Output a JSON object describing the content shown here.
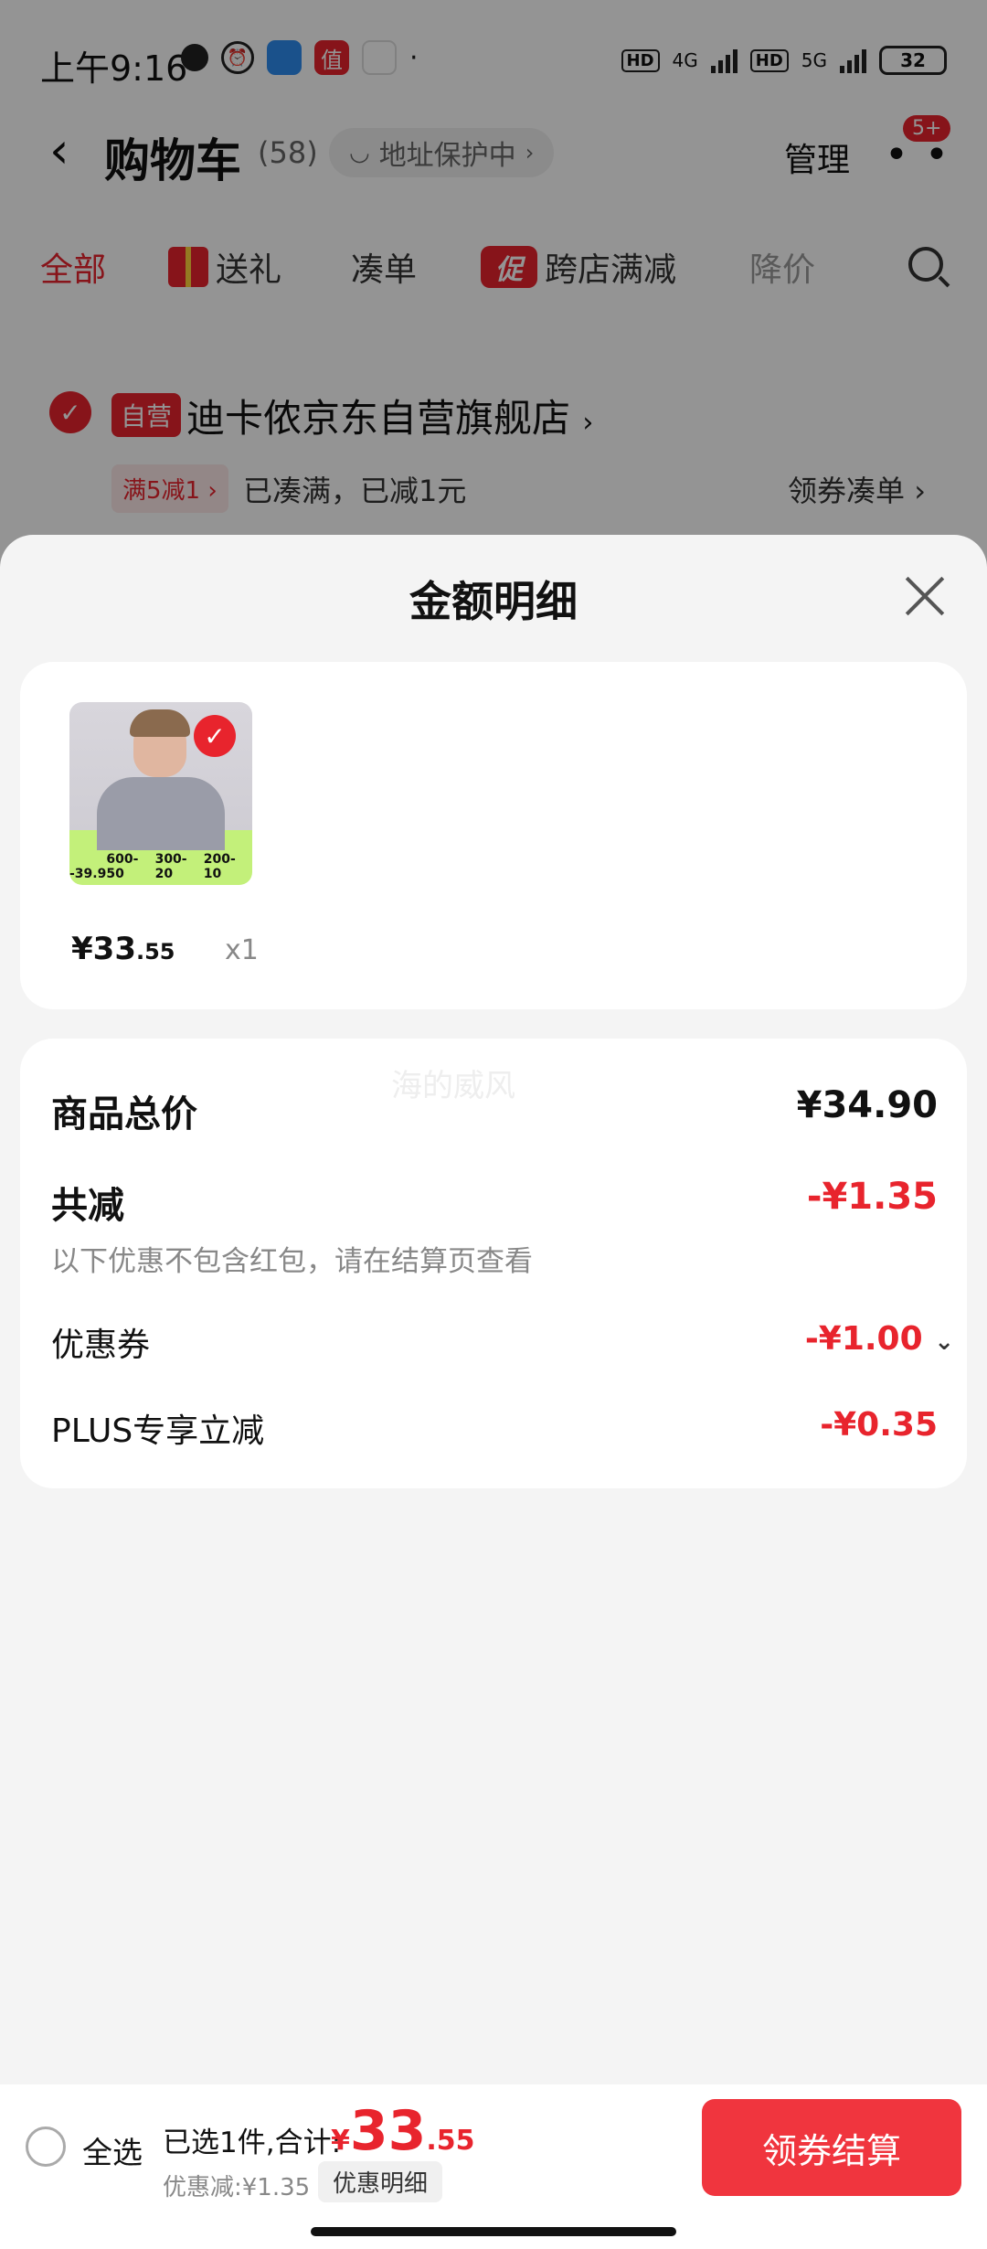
{
  "status_bar": {
    "time": "上午9:16",
    "network_1": "4G",
    "network_2": "5G",
    "hd": "HD",
    "battery": "32"
  },
  "header": {
    "title": "购物车",
    "count": "(58)",
    "address_protect": "地址保护中",
    "manage": "管理",
    "badge": "5+"
  },
  "tabs": [
    {
      "label": "全部"
    },
    {
      "label": "送礼"
    },
    {
      "label": "凑单"
    },
    {
      "label": "跨店满减",
      "icon_text": "促"
    },
    {
      "label": "降价"
    }
  ],
  "store": {
    "self_tag": "自营",
    "name": "迪卡侬京东自营旗舰店",
    "promo_tag": "满5减1",
    "promo_desc": "已凑满，已减1元",
    "coupon_link": "领券凑单"
  },
  "sheet": {
    "title": "金额明细",
    "product": {
      "price_int": "¥33",
      "price_dec": ".55",
      "qty": "x1",
      "strip_price": "-39.9",
      "strip_offers": [
        "600-50",
        "300-20",
        "200-10"
      ]
    },
    "watermark": "海的威风",
    "total_label": "商品总价",
    "total_value": "¥34.90",
    "reduce_label": "共减",
    "reduce_value": "-¥1.35",
    "note": "以下优惠不包含红包，请在结算页查看",
    "coupon_label": "优惠券",
    "coupon_value": "-¥1.00",
    "plus_label": "PLUS专享立减",
    "plus_value": "-¥0.35"
  },
  "bottom_bar": {
    "select_all": "全选",
    "summary": "已选1件,合计:",
    "total_cur": "¥",
    "total_int": "33",
    "total_dec": ".55",
    "discount": "优惠减:¥1.35",
    "detail_button": "优惠明细",
    "checkout": "领券结算"
  },
  "colors": {
    "accent": "#e8242d",
    "checkout_button": "#f0353e"
  }
}
